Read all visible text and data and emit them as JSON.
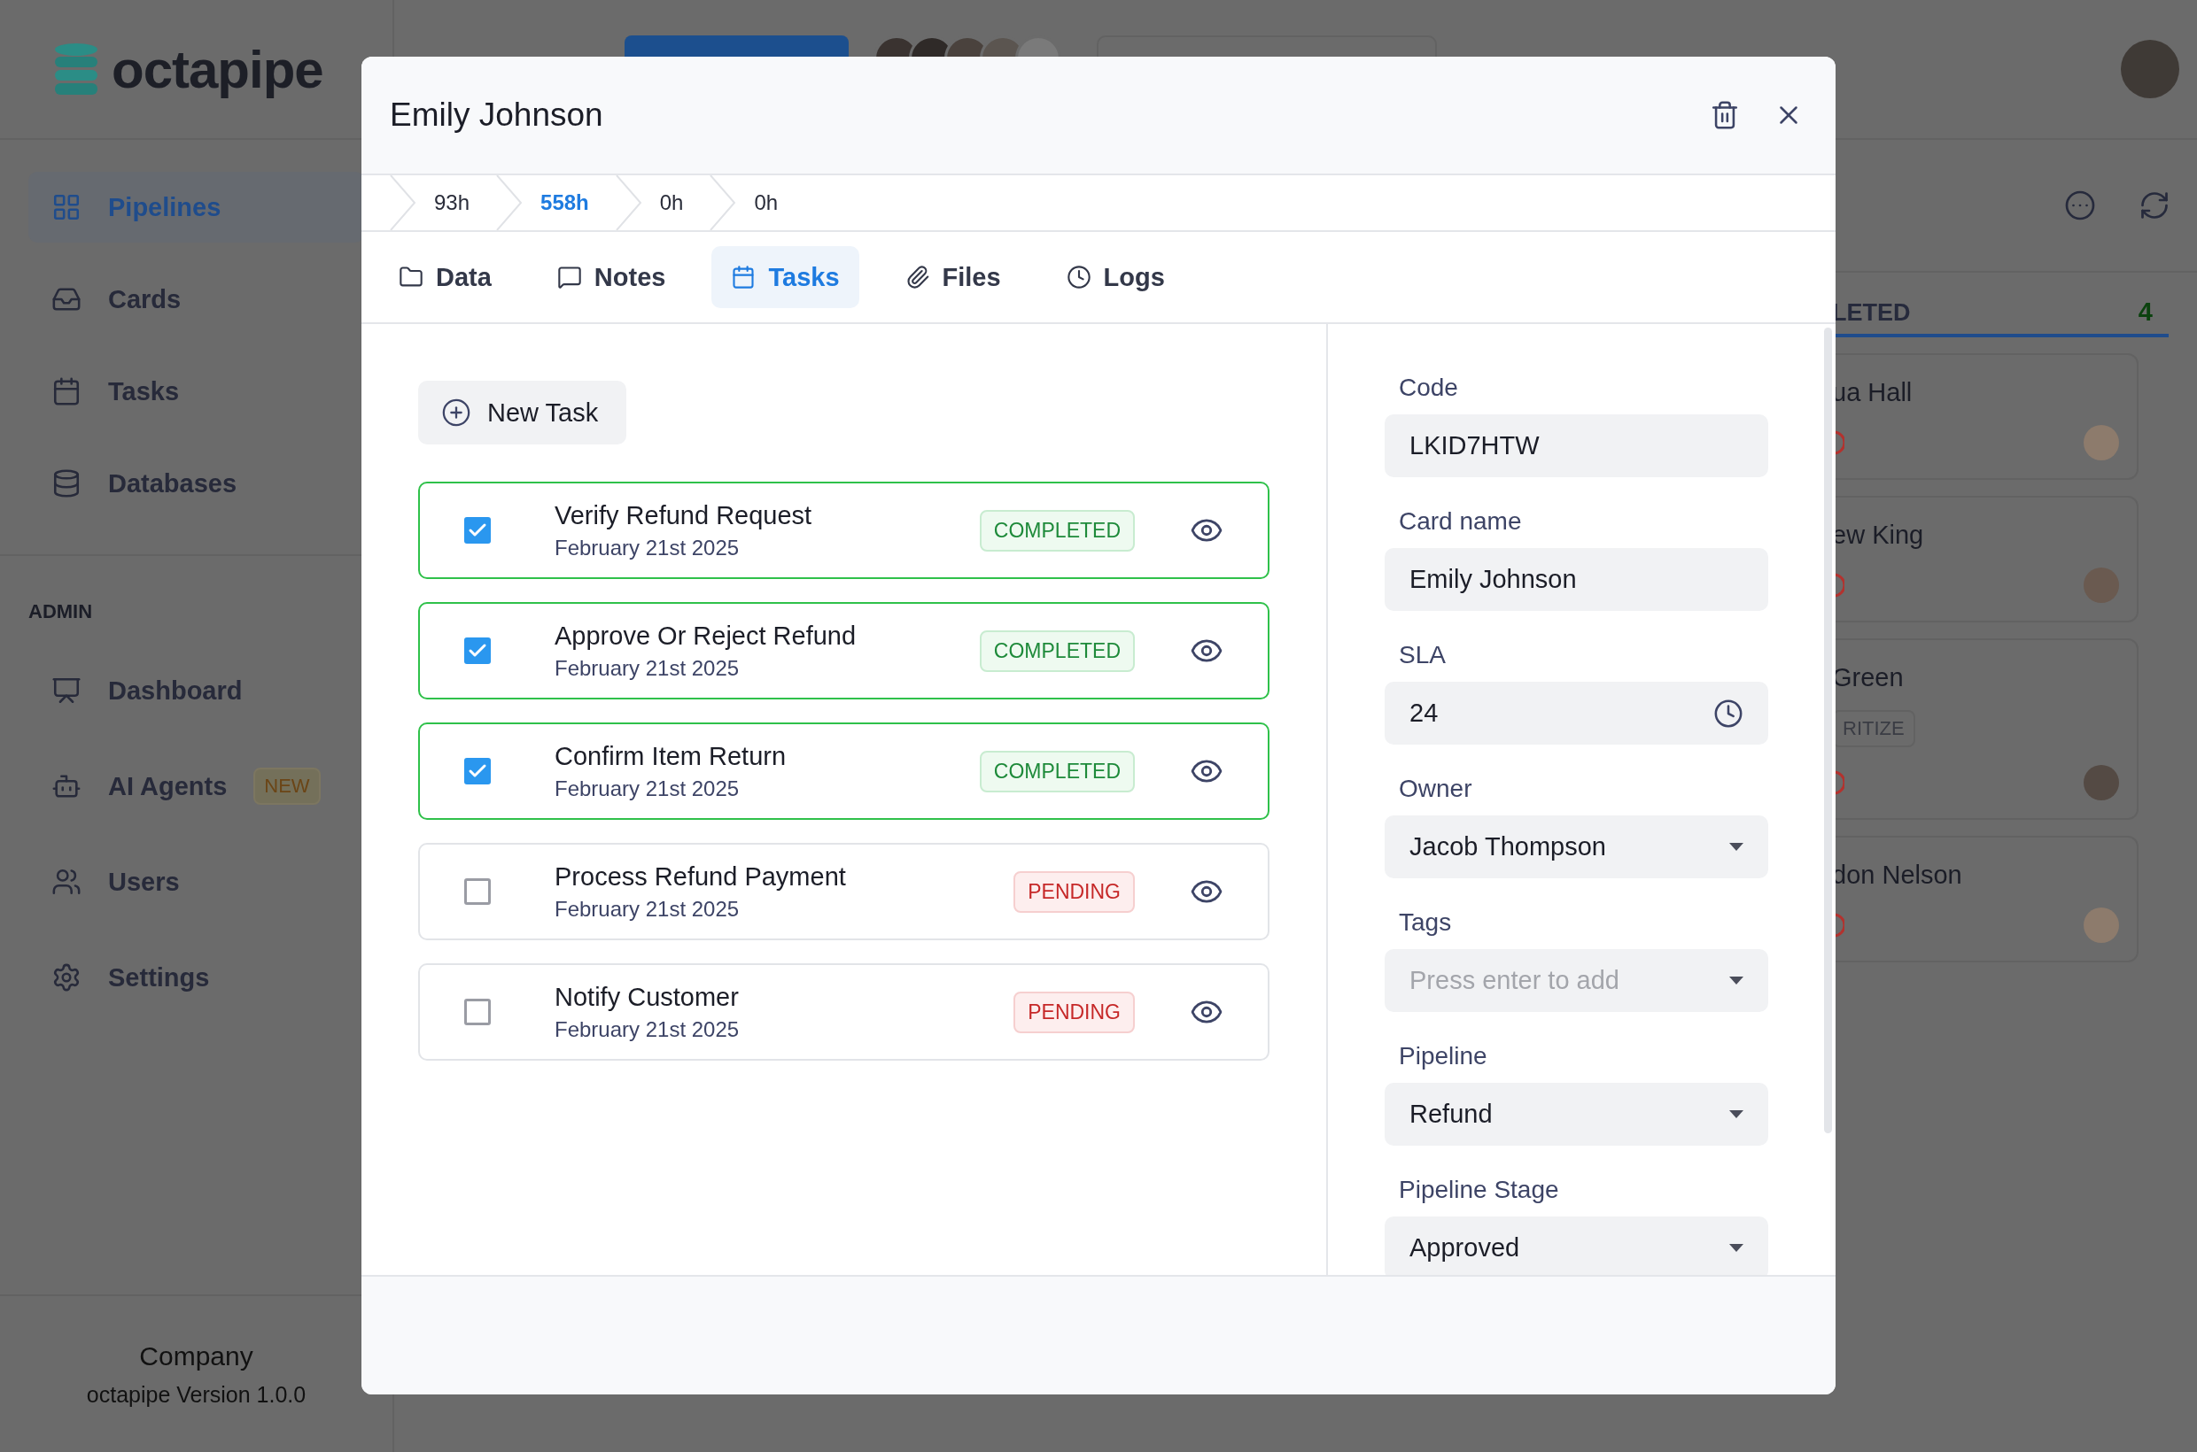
{
  "app": {
    "logo": "octapipe",
    "nav": [
      {
        "label": "Pipelines",
        "selected": true
      },
      {
        "label": "Cards",
        "selected": false
      },
      {
        "label": "Tasks",
        "selected": false
      },
      {
        "label": "Databases",
        "selected": false
      }
    ],
    "admin_heading": "ADMIN",
    "admin_nav": [
      {
        "label": "Dashboard"
      },
      {
        "label": "AI Agents",
        "badge": "NEW"
      },
      {
        "label": "Users"
      },
      {
        "label": "Settings"
      }
    ],
    "footer": {
      "company": "Company",
      "version": "octapipe Version 1.0.0"
    }
  },
  "board": {
    "column_title": "LETED",
    "column_count": "4",
    "cards": [
      {
        "name": "ua Hall"
      },
      {
        "name": "ew King"
      },
      {
        "name": "Green",
        "tag": "RITIZE"
      },
      {
        "name": "don Nelson"
      }
    ]
  },
  "modal": {
    "title": "Emily Johnson",
    "stages": [
      {
        "label": "93h",
        "selected": false
      },
      {
        "label": "558h",
        "selected": true
      },
      {
        "label": "0h",
        "selected": false
      },
      {
        "label": "0h",
        "selected": false
      }
    ],
    "tabs": [
      {
        "label": "Data",
        "selected": false
      },
      {
        "label": "Notes",
        "selected": false
      },
      {
        "label": "Tasks",
        "selected": true
      },
      {
        "label": "Files",
        "selected": false
      },
      {
        "label": "Logs",
        "selected": false
      }
    ],
    "new_task_button": "New Task",
    "tasks": [
      {
        "title": "Verify Refund Request",
        "date": "February 21st 2025",
        "checked": true,
        "status": "COMPLETED",
        "kind": "completed"
      },
      {
        "title": "Approve Or Reject Refund",
        "date": "February 21st 2025",
        "checked": true,
        "status": "COMPLETED",
        "kind": "completed"
      },
      {
        "title": "Confirm Item Return",
        "date": "February 21st 2025",
        "checked": true,
        "status": "COMPLETED",
        "kind": "completed"
      },
      {
        "title": "Process Refund Payment",
        "date": "February 21st 2025",
        "checked": false,
        "status": "PENDING",
        "kind": "pending"
      },
      {
        "title": "Notify Customer",
        "date": "February 21st 2025",
        "checked": false,
        "status": "PENDING",
        "kind": "pending"
      }
    ],
    "fields": [
      {
        "label": "Code",
        "kind": "text",
        "value": "LKID7HTW"
      },
      {
        "label": "Card name",
        "kind": "text",
        "value": "Emily Johnson"
      },
      {
        "label": "SLA",
        "kind": "time",
        "value": "24"
      },
      {
        "label": "Owner",
        "kind": "select",
        "value": "Jacob Thompson"
      },
      {
        "label": "Tags",
        "kind": "select",
        "placeholder": "Press enter to add"
      },
      {
        "label": "Pipeline",
        "kind": "select",
        "value": "Refund"
      },
      {
        "label": "Pipeline Stage",
        "kind": "select",
        "value": "Approved"
      }
    ]
  }
}
